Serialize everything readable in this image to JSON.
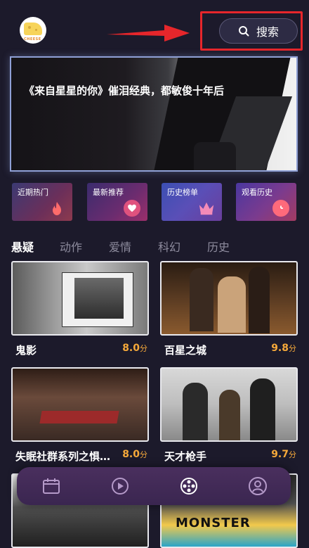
{
  "header": {
    "avatar_text": "CHEESE",
    "search_label": "搜索",
    "arrow_color": "#e6262b",
    "highlight_color": "#e6262b"
  },
  "banner": {
    "title": "《来自星星的你》催泪经典，都敏俊十年后"
  },
  "categories": [
    {
      "label": "近期热门",
      "icon": "flame-icon"
    },
    {
      "label": "最新推荐",
      "icon": "heart-icon"
    },
    {
      "label": "历史榜单",
      "icon": "crown-icon"
    },
    {
      "label": "观看历史",
      "icon": "clock-icon"
    }
  ],
  "genre_tabs": [
    {
      "label": "悬疑",
      "active": true
    },
    {
      "label": "动作",
      "active": false
    },
    {
      "label": "爱情",
      "active": false
    },
    {
      "label": "科幻",
      "active": false
    },
    {
      "label": "历史",
      "active": false
    }
  ],
  "movies": [
    {
      "title": "鬼影",
      "score": "8.0",
      "unit": "分"
    },
    {
      "title": "百星之城",
      "score": "9.8",
      "unit": "分"
    },
    {
      "title": "失眠社群系列之惧暗...",
      "score": "8.0",
      "unit": "分"
    },
    {
      "title": "天才枪手",
      "score": "9.7",
      "unit": "分"
    },
    {
      "title": "",
      "score": "",
      "unit": ""
    },
    {
      "title": "",
      "score": "",
      "unit": "",
      "poster_text": "MONSTER"
    }
  ],
  "tabbar": [
    {
      "icon": "calendar-icon",
      "active": false
    },
    {
      "icon": "play-icon",
      "active": false
    },
    {
      "icon": "film-reel-icon",
      "active": true
    },
    {
      "icon": "user-icon",
      "active": false
    }
  ],
  "colors": {
    "background": "#1c1a2b",
    "score": "#f6a93a",
    "tabbar": "#4a2f5e"
  }
}
